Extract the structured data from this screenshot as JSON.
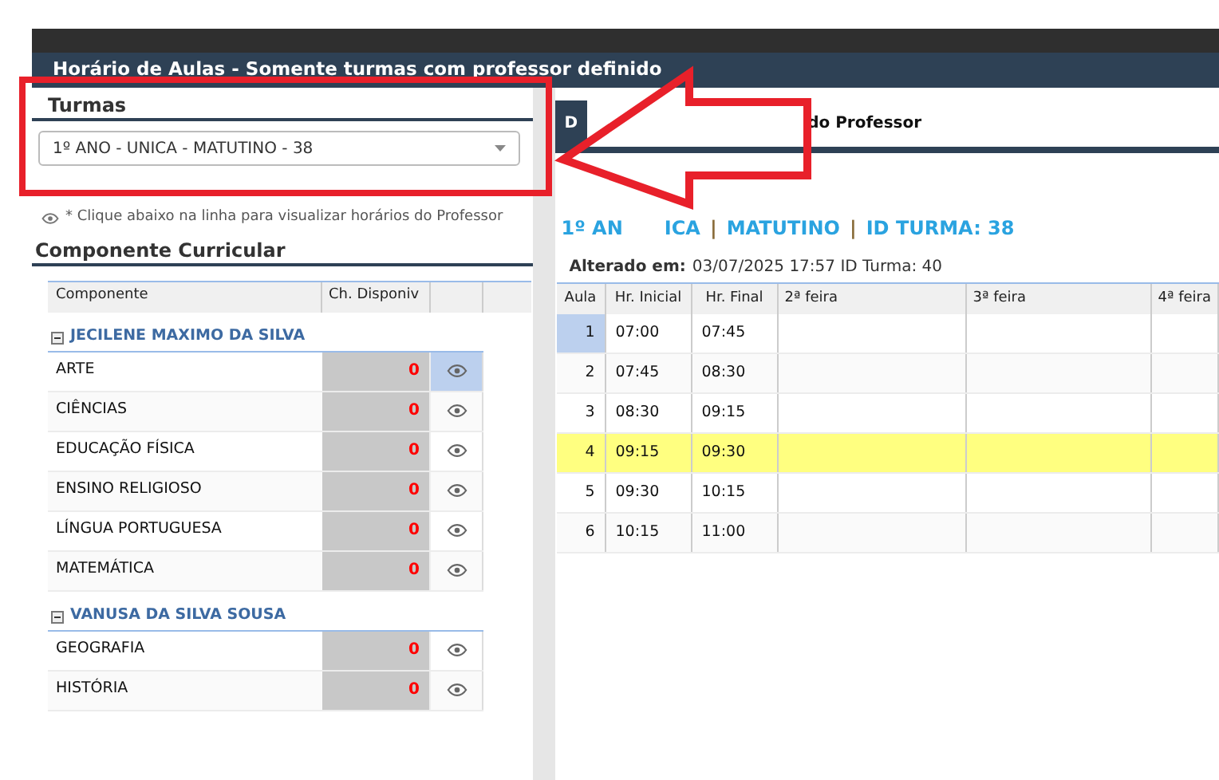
{
  "title": "Horário de Aulas - Somente turmas com professor definido",
  "turmas": {
    "heading": "Turmas",
    "select": {
      "value": "1º ANO - UNICA - MATUTINO - 38"
    },
    "hint": "* Clique abaixo na linha para visualizar horários do Professor"
  },
  "componente": {
    "heading": "Componente Curricular",
    "columns": [
      "Componente",
      "Ch. Disponiv"
    ],
    "groups": [
      {
        "teacher": "JECILENE MAXIMO DA SILVA",
        "expanded": true,
        "rows": [
          {
            "name": "ARTE",
            "hours": "0",
            "selected": true
          },
          {
            "name": "CIÊNCIAS",
            "hours": "0",
            "selected": false
          },
          {
            "name": "EDUCAÇÃO FÍSICA",
            "hours": "0",
            "selected": false
          },
          {
            "name": "ENSINO RELIGIOSO",
            "hours": "0",
            "selected": false
          },
          {
            "name": "LÍNGUA PORTUGUESA",
            "hours": "0",
            "selected": false
          },
          {
            "name": "MATEMÁTICA",
            "hours": "0",
            "selected": false
          }
        ]
      },
      {
        "teacher": "VANUSA DA SILVA SOUSA",
        "expanded": true,
        "rows": [
          {
            "name": "GEOGRAFIA",
            "hours": "0",
            "selected": false
          },
          {
            "name": "HISTÓRIA",
            "hours": "0",
            "selected": false
          }
        ]
      }
    ]
  },
  "schedule": {
    "tabs": [
      {
        "label": "D",
        "selected": true
      },
      {
        "label": "do Professor",
        "selected": false
      }
    ],
    "heading": [
      {
        "text": "1º AN",
        "kind": "value"
      },
      {
        "text": "ICA",
        "kind": "value"
      },
      {
        "text": "|",
        "kind": "separator"
      },
      {
        "text": "MATUTINO",
        "kind": "value"
      },
      {
        "text": "|",
        "kind": "separator"
      },
      {
        "text": "ID TURMA: 38",
        "kind": "value"
      }
    ],
    "altered_label": "Alterado em:",
    "altered_value": "03/07/2025 17:57 ID Turma: 40",
    "columns": [
      "Aula",
      "Hr. Inicial",
      "Hr. Final",
      "2ª feira",
      "3ª feira",
      "4ª feira"
    ],
    "rows": [
      {
        "aula": "1",
        "start": "07:00",
        "end": "07:45",
        "selected": true,
        "highlighted": false
      },
      {
        "aula": "2",
        "start": "07:45",
        "end": "08:30",
        "selected": false,
        "highlighted": false
      },
      {
        "aula": "3",
        "start": "08:30",
        "end": "09:15",
        "selected": false,
        "highlighted": false
      },
      {
        "aula": "4",
        "start": "09:15",
        "end": "09:30",
        "selected": false,
        "highlighted": true
      },
      {
        "aula": "5",
        "start": "09:30",
        "end": "10:15",
        "selected": false,
        "highlighted": false
      },
      {
        "aula": "6",
        "start": "10:15",
        "end": "11:00",
        "selected": false,
        "highlighted": false
      }
    ]
  }
}
